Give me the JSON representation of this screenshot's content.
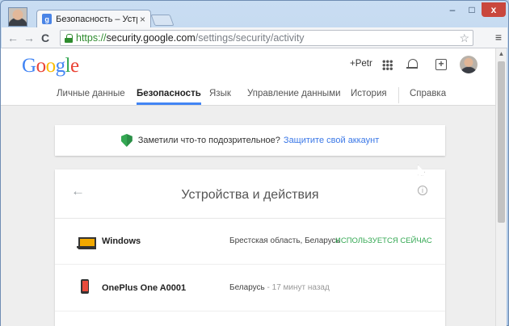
{
  "window": {
    "tab_title": "Безопасность – Устройств",
    "tab_favicon": "g",
    "tab_close": "×",
    "min_label": "–",
    "max_label": "□",
    "close_label": "x"
  },
  "toolbar": {
    "back_icon": "←",
    "forward_icon": "→",
    "reload_icon": "C",
    "url_scheme": "https://",
    "url_host": "security.google.com",
    "url_path": "/settings/security/activity",
    "star_icon": "☆",
    "menu_icon": "≡"
  },
  "header": {
    "logo": [
      "G",
      "o",
      "o",
      "g",
      "l",
      "e"
    ],
    "plus_user": "+Petr",
    "share_icon": "+"
  },
  "nav": {
    "items": [
      "Личные данные",
      "Безопасность",
      "Язык",
      "Управление данными",
      "История",
      "Справка"
    ],
    "active_index": 1
  },
  "alert": {
    "text": "Заметили что-то подозрительное?",
    "link": "Защитите свой аккаунт"
  },
  "card": {
    "back_icon": "←",
    "title": "Устройства и действия",
    "info_icon": "i",
    "devices": [
      {
        "name": "Windows",
        "location": "Брестская область, Беларусь",
        "status": "ИСПОЛЬЗУЕТСЯ СЕЙЧАС",
        "icon": "laptop-icon"
      },
      {
        "name": "OnePlus One A0001",
        "location": "Беларусь",
        "time": " - 17 минут назад",
        "icon": "phone-icon"
      }
    ]
  },
  "colors": {
    "accent": "#4285f4",
    "link": "#3b78e7",
    "status_green": "#34a853"
  }
}
